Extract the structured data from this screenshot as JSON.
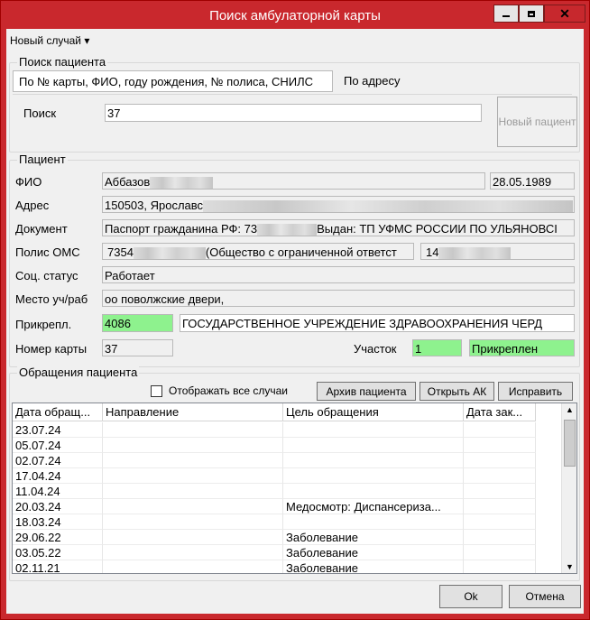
{
  "window": {
    "title": "Поиск амбулаторной карты"
  },
  "menu": {
    "new_case": "Новый случай ▾"
  },
  "search": {
    "group_title": "Поиск пациента",
    "tabs": [
      "По № карты, ФИО, году рождения, № полиса, СНИЛС",
      "По адресу"
    ],
    "label": "Поиск",
    "value": "37",
    "new_patient": "Новый пациент"
  },
  "patient": {
    "group_title": "Пациент",
    "labels": {
      "fio": "ФИО",
      "address": "Адрес",
      "document": "Документ",
      "policy": "Полис ОМС",
      "social": "Соц. статус",
      "workplace": "Место уч/раб",
      "attached": "Прикрепл.",
      "card_no": "Номер карты",
      "district": "Участок"
    },
    "fio": "Аббазов",
    "birth_date": "28.05.1989",
    "address": "150503, Ярославс",
    "document_a": "Паспорт гражданина РФ: 73",
    "document_b": "Выдан: ТП УФМС РОССИИ ПО УЛЬЯНОВСІ",
    "policy_a": "7354",
    "policy_b": "(Общество с ограниченной ответст",
    "policy_c": "14",
    "social": "Работает",
    "workplace": "оо поволжские двери,",
    "attach_code": "4086",
    "attach_org": "ГОСУДАРСТВЕННОЕ УЧРЕЖДЕНИЕ ЗДРАВООХРАНЕНИЯ ЧЕРД",
    "card_no": "37",
    "district": "1",
    "attach_status": "Прикреплен"
  },
  "visits": {
    "group_title": "Обращения пациента",
    "show_all": "Отображать все случаи",
    "buttons": {
      "archive": "Архив пациента",
      "open": "Открыть АК",
      "fix": "Исправить"
    },
    "columns": [
      "Дата обращ...",
      "Направление",
      "Цель обращения",
      "Дата зак..."
    ],
    "rows": [
      {
        "date": "23.07.24",
        "direction": "",
        "purpose": "",
        "closed": ""
      },
      {
        "date": "05.07.24",
        "direction": "",
        "purpose": "",
        "closed": ""
      },
      {
        "date": "02.07.24",
        "direction": "",
        "purpose": "",
        "closed": ""
      },
      {
        "date": "17.04.24",
        "direction": "",
        "purpose": "",
        "closed": ""
      },
      {
        "date": "11.04.24",
        "direction": "",
        "purpose": "",
        "closed": ""
      },
      {
        "date": "20.03.24",
        "direction": "",
        "purpose": "Медосмотр: Диспансериза...",
        "closed": ""
      },
      {
        "date": "18.03.24",
        "direction": "",
        "purpose": "",
        "closed": ""
      },
      {
        "date": "29.06.22",
        "direction": "",
        "purpose": "Заболевание",
        "closed": ""
      },
      {
        "date": "03.05.22",
        "direction": "",
        "purpose": "Заболевание",
        "closed": ""
      },
      {
        "date": "02.11.21",
        "direction": "",
        "purpose": "Заболевание",
        "closed": ""
      }
    ]
  },
  "footer": {
    "ok": "Ok",
    "cancel": "Отмена"
  }
}
